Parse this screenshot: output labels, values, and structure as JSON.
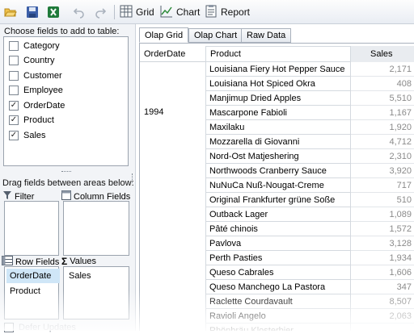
{
  "toolbar": {
    "grid_label": "Grid",
    "chart_label": "Chart",
    "report_label": "Report"
  },
  "field_list": {
    "caption": "Choose fields to add to table:",
    "fields": [
      {
        "label": "Category",
        "checked": false
      },
      {
        "label": "Country",
        "checked": false
      },
      {
        "label": "Customer",
        "checked": false
      },
      {
        "label": "Employee",
        "checked": false
      },
      {
        "label": "OrderDate",
        "checked": true
      },
      {
        "label": "Product",
        "checked": true
      },
      {
        "label": "Sales",
        "checked": true
      }
    ]
  },
  "areas": {
    "caption": "Drag fields between areas below:",
    "filter_label": "Filter",
    "column_label": "Column Fields",
    "row_label": "Row Fields",
    "values_label": "Values",
    "row_items": [
      "OrderDate",
      "Product"
    ],
    "value_items": [
      "Sales"
    ],
    "defer_label": "Defer Updates"
  },
  "tabs": [
    "Olap Grid",
    "Olap Chart",
    "Raw Data"
  ],
  "grid": {
    "headers": {
      "orderdate": "OrderDate",
      "product": "Product",
      "sales": "Sales"
    },
    "year": "1994",
    "rows": [
      {
        "product": "Louisiana Fiery Hot Pepper Sauce",
        "sales": "2,171"
      },
      {
        "product": "Louisiana Hot Spiced Okra",
        "sales": "408"
      },
      {
        "product": "Manjimup Dried Apples",
        "sales": "5,510"
      },
      {
        "product": "Mascarpone Fabioli",
        "sales": "1,167"
      },
      {
        "product": "Maxilaku",
        "sales": "1,920"
      },
      {
        "product": "Mozzarella di Giovanni",
        "sales": "4,712"
      },
      {
        "product": "Nord-Ost Matjeshering",
        "sales": "2,310"
      },
      {
        "product": "Northwoods Cranberry Sauce",
        "sales": "3,920"
      },
      {
        "product": "NuNuCa Nuß-Nougat-Creme",
        "sales": "717"
      },
      {
        "product": "Original Frankfurter grüne Soße",
        "sales": "510"
      },
      {
        "product": "Outback Lager",
        "sales": "1,089"
      },
      {
        "product": "Pâté chinois",
        "sales": "1,572"
      },
      {
        "product": "Pavlova",
        "sales": "3,128"
      },
      {
        "product": "Perth Pasties",
        "sales": "1,934"
      },
      {
        "product": "Queso Cabrales",
        "sales": "1,606"
      },
      {
        "product": "Queso Manchego La Pastora",
        "sales": "347"
      },
      {
        "product": "Raclette Courdavault",
        "sales": "8,507"
      },
      {
        "product": "Ravioli Angelo",
        "sales": "2,063"
      },
      {
        "product": "Rhönbräu Klosterbier",
        "sales": ""
      }
    ]
  }
}
